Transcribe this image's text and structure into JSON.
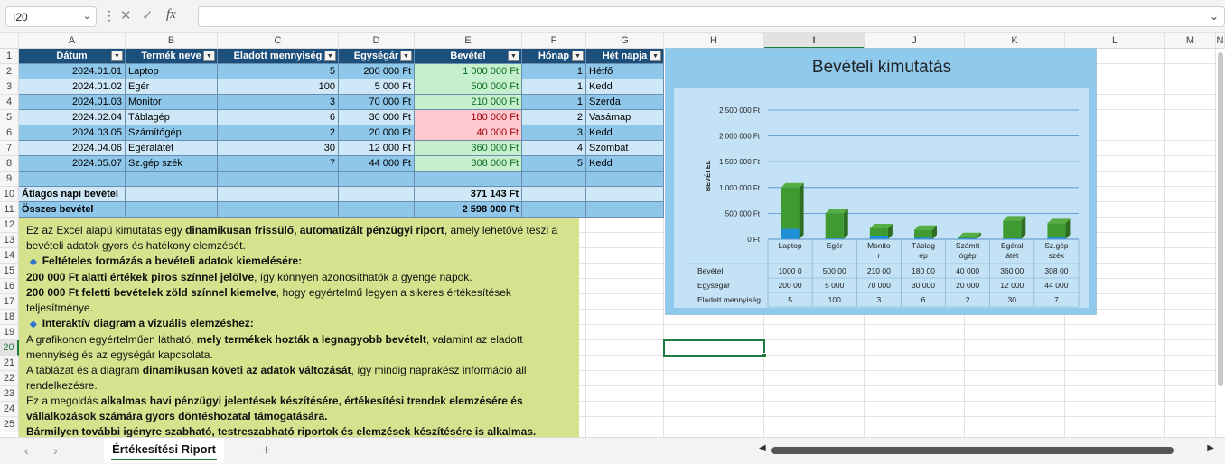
{
  "namebox": {
    "value": "I20",
    "chev": "⌄"
  },
  "formula": {
    "fx": "fx",
    "dots": "⋮",
    "cancel": "✕",
    "confirm": "✓",
    "chev": "⌄"
  },
  "cols": [
    "A",
    "B",
    "C",
    "D",
    "E",
    "F",
    "G",
    "H",
    "I",
    "J",
    "K",
    "L",
    "M",
    "N"
  ],
  "rows": [
    "1",
    "2",
    "3",
    "4",
    "5",
    "6",
    "7",
    "8",
    "9",
    "10",
    "11",
    "12",
    "13",
    "14",
    "15",
    "16",
    "17",
    "18",
    "19",
    "20",
    "21",
    "22",
    "23",
    "24",
    "25"
  ],
  "table": {
    "headers": [
      "Dátum",
      "Termék neve",
      "Eladott mennyiség",
      "Egységár",
      "Bevétel",
      "Hónap",
      "Hét napja"
    ],
    "dd": "▼",
    "data": [
      [
        "2024.01.01",
        "Laptop",
        "5",
        "200 000 Ft",
        "1 000 000 Ft",
        "1",
        "Hétfő"
      ],
      [
        "2024.01.02",
        "Egér",
        "100",
        "5 000 Ft",
        "500 000 Ft",
        "1",
        "Kedd"
      ],
      [
        "2024.01.03",
        "Monitor",
        "3",
        "70 000 Ft",
        "210 000 Ft",
        "1",
        "Szerda"
      ],
      [
        "2024.02.04",
        "Táblagép",
        "6",
        "30 000 Ft",
        "180 000 Ft",
        "2",
        "Vasárnap"
      ],
      [
        "2024.03.05",
        "Számítógép",
        "2",
        "20 000 Ft",
        "40 000 Ft",
        "3",
        "Kedd"
      ],
      [
        "2024.04.06",
        "Egéralátét",
        "30",
        "12 000 Ft",
        "360 000 Ft",
        "4",
        "Szombat"
      ],
      [
        "2024.05.07",
        "Sz.gép szék",
        "7",
        "44 000 Ft",
        "308 000 Ft",
        "5",
        "Kedd"
      ]
    ],
    "avg_label": "Átlagos napi bevétel",
    "avg_value": "371 143 Ft",
    "total_label": "Összes bevétel",
    "total_value": "2 598 000 Ft"
  },
  "textbox": {
    "l1a": "Ez az Excel alapú kimutatás egy ",
    "l1b": "dinamikusan frissülő, automatizált pénzügyi riport",
    "l1c": ", amely lehetővé teszi a bevételi adatok gyors és hatékony elemzését.",
    "h1": "Feltételes formázás a bevételi adatok kiemelésére:",
    "l2a": "200 000 Ft alatti értékek piros színnel jelölve",
    "l2b": ", így könnyen azonosíthatók a gyenge napok.",
    "l3a": "200 000 Ft feletti bevételek zöld színnel kiemelve",
    "l3b": ", hogy egyértelmű legyen a sikeres értékesítések teljesítménye.",
    "h2": "Interaktív diagram a vizuális elemzéshez:",
    "l4a": "A grafikonon egyértelműen látható, ",
    "l4b": "mely termékek hozták a legnagyobb bevételt",
    "l4c": ", valamint az eladott mennyiség és az egységár kapcsolata.",
    "l5a": "A táblázat és a diagram ",
    "l5b": "dinamikusan követi az adatok változását",
    "l5c": ", így mindig naprakész információ áll rendelkezésre.",
    "l6a": "Ez a megoldás ",
    "l6b": "alkalmas havi pénzügyi jelentések készítésére, értékesítési trendek elemzésére és vállalkozások számára gyors döntéshozatal támogatására.",
    "l7": " Bármilyen további igényre szabható, testreszabható riportok és elemzések készítésére is alkalmas.",
    "bullet": "◆"
  },
  "chart_data": {
    "type": "bar",
    "title": "Bevételi kimutatás",
    "ylabel": "BEVÉTEL",
    "categories": [
      [
        "Laptop"
      ],
      [
        "Egér"
      ],
      [
        "Monito",
        "r"
      ],
      [
        "Táblag",
        "ép"
      ],
      [
        "Számít",
        "ógép"
      ],
      [
        "Egéral",
        "átét"
      ],
      [
        "Sz.gép",
        "szék"
      ]
    ],
    "yticks": [
      "2 500 000 Ft",
      "2 000 000 Ft",
      "1 500 000 Ft",
      "1 000 000 Ft",
      "500 000 Ft",
      "0 Ft"
    ],
    "ylim": [
      0,
      2500000
    ],
    "series": [
      {
        "name": "Bevétel",
        "values": [
          1000000,
          500000,
          210000,
          180000,
          40000,
          360000,
          308000
        ],
        "labels": [
          "1000 0",
          "500 00",
          "210 00",
          "180 00",
          "40 000",
          "360 00",
          "308 00"
        ],
        "color": "#3f9b31"
      },
      {
        "name": "Egységár",
        "values": [
          200000,
          5000,
          70000,
          30000,
          20000,
          12000,
          44000
        ],
        "labels": [
          "200 00",
          "5 000",
          "70 000",
          "30 000",
          "20 000",
          "12 000",
          "44 000"
        ],
        "color": "#1f8fd6"
      },
      {
        "name": "Eladott mennyiség",
        "values": [
          5,
          100,
          3,
          6,
          2,
          30,
          7
        ],
        "labels": [
          "5",
          "100",
          "3",
          "6",
          "2",
          "30",
          "7"
        ],
        "color": "#888888"
      }
    ]
  },
  "tabs": {
    "sheet": "Értékesítési Riport",
    "prev": "‹",
    "next": "›",
    "add": "+"
  }
}
